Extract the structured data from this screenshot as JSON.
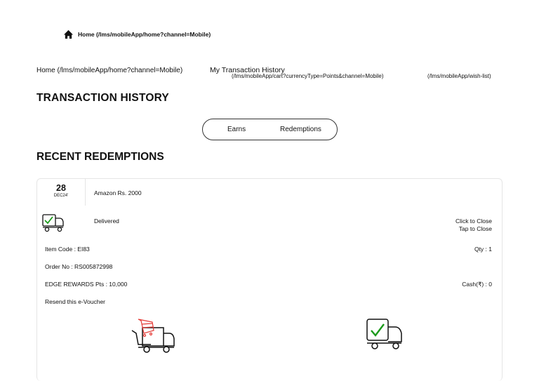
{
  "top_nav": {
    "home_link": "Home (/lms/mobileApp/home?channel=Mobile)",
    "home_icon": "home-icon"
  },
  "breadcrumb": {
    "home": "Home (/lms/mobileApp/home?channel=Mobile)",
    "current": "My Transaction History",
    "cart_link": "(/lms/mobileApp/cart?currencyType=Points&channel=Mobile)",
    "wishlist_link": "(/lms/mobileApp/wish-list)"
  },
  "page_title": "TRANSACTION HISTORY",
  "tabs": {
    "earns": "Earns",
    "redemptions": "Redemptions"
  },
  "section_title": "RECENT REDEMPTIONS",
  "redemption": {
    "day": "28",
    "month": "DEC24'",
    "item_name": "Amazon Rs. 2000",
    "status": "Delivered",
    "status_icon": "delivered-truck-icon",
    "click_to_close": "Click to Close",
    "tap_to_close": "Tap to Close",
    "item_code": "Item Code     : EI83",
    "qty": "Qty : 1",
    "order_no": "Order No : RS005872998",
    "points": "EDGE REWARDS Pts : 10,000",
    "cash": "Cash(₹) : 0",
    "resend": "Resend this e-Voucher"
  },
  "colors": {
    "check_green": "#1a9a1a",
    "cart_red": "#e53935",
    "border": "#e5e5e5"
  }
}
